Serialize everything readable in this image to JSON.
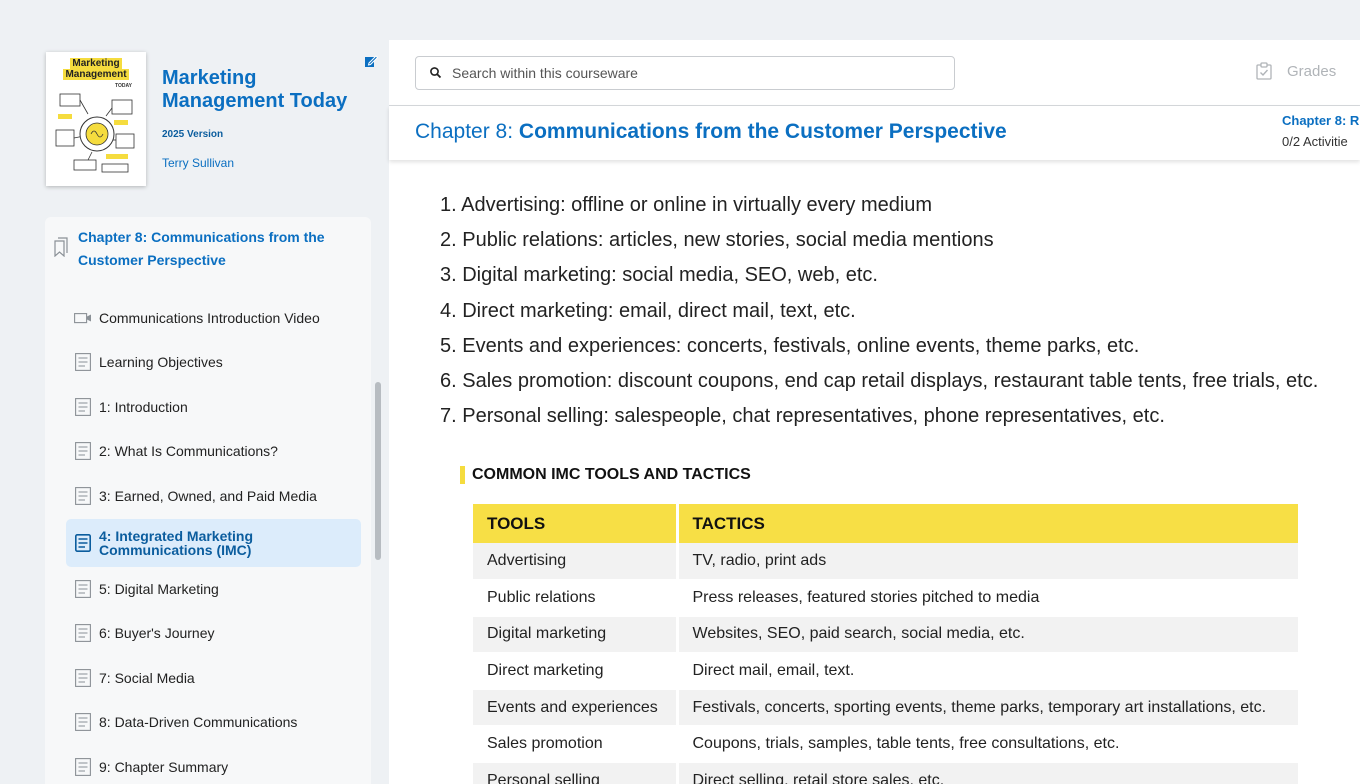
{
  "book": {
    "cover_title_line1": "Marketing",
    "cover_title_line2": "Management",
    "cover_subtitle": "TODAY",
    "title": "Marketing Management Today",
    "version": "2025 Version",
    "author": "Terry Sullivan"
  },
  "toc": {
    "chapter_title": "Chapter 8: Communications from the Customer Perspective",
    "items": [
      {
        "label": "Communications Introduction Video",
        "icon": "video-icon"
      },
      {
        "label": "Learning Objectives",
        "icon": "document-icon"
      },
      {
        "label": "1: Introduction",
        "icon": "document-icon"
      },
      {
        "label": "2: What Is Communications?",
        "icon": "document-icon"
      },
      {
        "label": "3: Earned, Owned, and Paid Media",
        "icon": "document-icon"
      },
      {
        "label": "4: Integrated Marketing Communications (IMC)",
        "icon": "document-icon",
        "active": true
      },
      {
        "label": "5: Digital Marketing",
        "icon": "document-icon"
      },
      {
        "label": "6: Buyer's Journey",
        "icon": "document-icon"
      },
      {
        "label": "7: Social Media",
        "icon": "document-icon"
      },
      {
        "label": "8: Data-Driven Communications",
        "icon": "document-icon"
      },
      {
        "label": "9: Chapter Summary",
        "icon": "document-icon"
      }
    ]
  },
  "topbar": {
    "search_placeholder": "Search within this courseware",
    "grades_label": "Grades"
  },
  "chapter_bar": {
    "prefix": "Chapter 8: ",
    "title": "Communications from the Customer Perspective",
    "progress_title": "Chapter 8: R",
    "progress_count": "0/2 Activitie"
  },
  "content": {
    "list": [
      "1. Advertising: offline or online in virtually every medium",
      "2. Public relations: articles, new stories, social media mentions",
      "3. Digital marketing: social media, SEO, web, etc.",
      "4. Direct marketing: email, direct mail, text, etc.",
      "5. Events and experiences: concerts, festivals, online events, theme parks, etc.",
      "6. Sales promotion: discount coupons, end cap retail displays, restaurant table tents, free trials, etc.",
      "7. Personal selling: salespeople, chat representatives, phone representatives, etc."
    ],
    "table": {
      "caption": "COMMON IMC TOOLS AND TACTICS",
      "headers": [
        "TOOLS",
        "TACTICS"
      ],
      "rows": [
        [
          "Advertising",
          "TV, radio, print ads"
        ],
        [
          "Public relations",
          "Press releases, featured stories pitched to media"
        ],
        [
          "Digital marketing",
          "Websites, SEO, paid search, social media, etc."
        ],
        [
          "Direct marketing",
          "Direct mail, email, text."
        ],
        [
          "Events and experiences",
          "Festivals, concerts, sporting events, theme parks, temporary art installations, etc."
        ],
        [
          "Sales promotion",
          "Coupons, trials, samples, table tents, free consultations, etc."
        ],
        [
          "Personal selling",
          "Direct selling, retail store sales, etc."
        ]
      ]
    }
  },
  "colors": {
    "brand_blue": "#0b6fc1",
    "accent_yellow": "#f7df45",
    "active_bg": "#dcecfb"
  }
}
